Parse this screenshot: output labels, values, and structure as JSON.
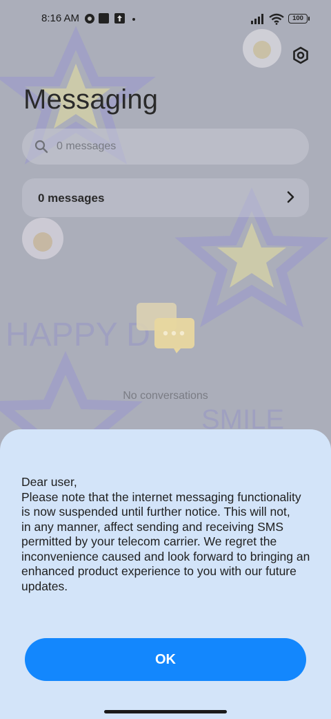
{
  "status_bar": {
    "time": "8:16 AM",
    "battery": "100"
  },
  "header": {
    "title": "Messaging"
  },
  "search": {
    "placeholder": "0 messages"
  },
  "summary_row": {
    "label": "0 messages"
  },
  "empty_state": {
    "text": "No conversations"
  },
  "wallpaper_text": {
    "happy": "HAPPY D",
    "smile": "SMILE"
  },
  "dialog": {
    "lines": [
      "Dear user,",
      "Please note that the internet messaging functionality",
      "is now suspended until further notice. This will not,",
      "in any manner, affect sending and receiving SMS",
      "permitted by your telecom carrier. We regret the",
      "inconvenience caused and look forward to bringing an",
      "enhanced product experience to you with our future",
      "updates."
    ],
    "ok_label": "OK"
  },
  "colors": {
    "accent": "#1387fd",
    "sheet": "#d3e4f9"
  }
}
